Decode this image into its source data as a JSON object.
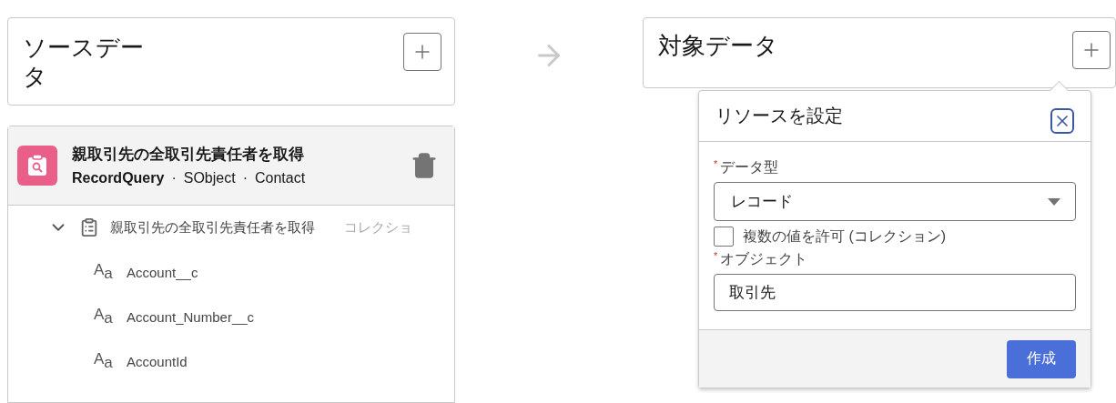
{
  "source": {
    "title": "ソースデータ"
  },
  "target": {
    "title": "対象データ"
  },
  "query": {
    "title": "親取引先の全取引先責任者を取得",
    "type": "RecordQuery",
    "separator": "·",
    "meta": [
      "SObject",
      "Contact"
    ],
    "tree": [
      {
        "label": "親取引先の全取引先責任者を取得",
        "tag": "コレクショ",
        "expanded": true,
        "children": [
          {
            "icon_text": "A$_{a}$",
            "label": "Account__c"
          },
          {
            "icon_text": "A$_{a}$",
            "label": "Account_Number__c"
          },
          {
            "icon_text": "A$_{a}$",
            "label": "AccountId"
          }
        ]
      }
    ]
  },
  "popover": {
    "title": "リソースを設定",
    "fields": [
      {
        "kind": "select",
        "mark": "*",
        "label": "データ型",
        "value": "レコード"
      },
      {
        "kind": "checkbox",
        "label": "複数の値を許可 (コレクション)",
        "checked": false
      },
      {
        "kind": "text",
        "mark": "*",
        "label": "オブジェクト",
        "value": "取引先"
      }
    ],
    "buttons": [
      "作成"
    ]
  }
}
